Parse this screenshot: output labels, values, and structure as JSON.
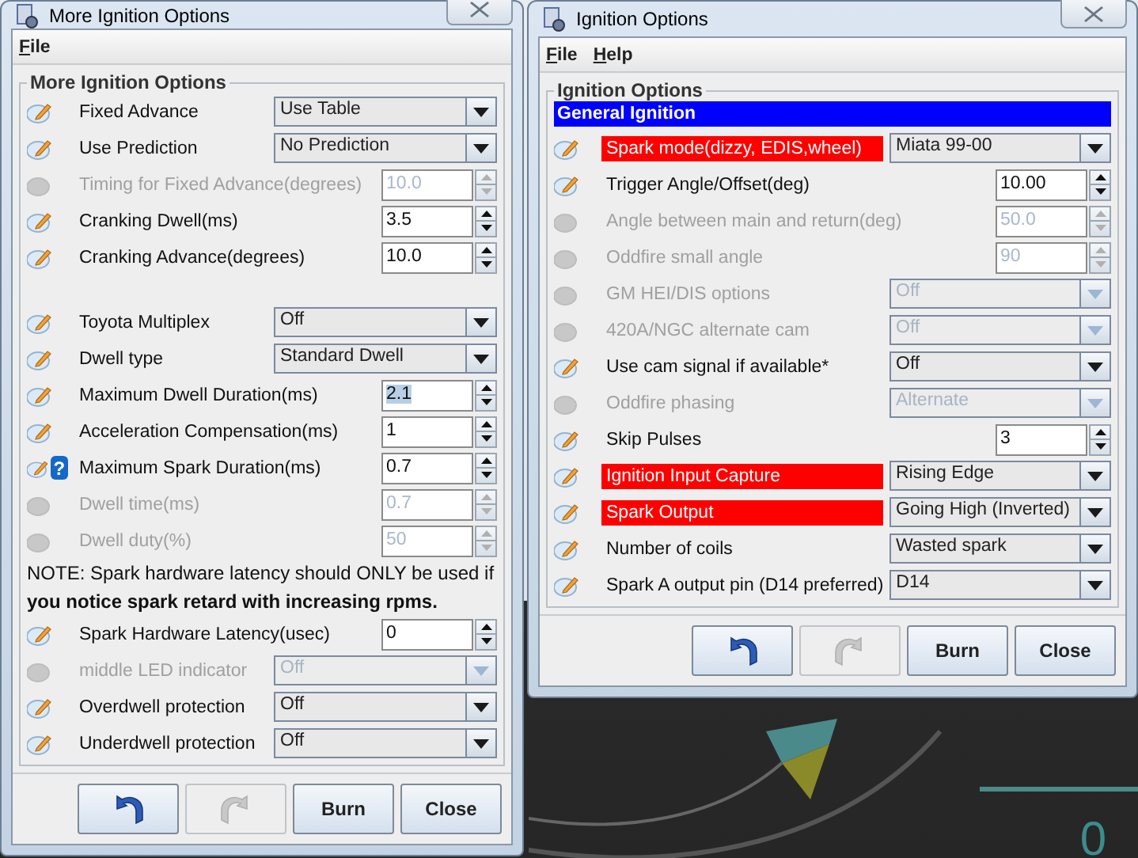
{
  "windows": [
    {
      "title": "More Ignition Options",
      "menu": [
        {
          "label": "File"
        }
      ],
      "group_title": "More Ignition Options",
      "rows": [
        {
          "kind": "combo",
          "label": "Fixed Advance",
          "value": "Use Table",
          "disabled": false,
          "highlighted": false
        },
        {
          "kind": "combo",
          "label": "Use Prediction",
          "value": "No Prediction",
          "disabled": false,
          "highlighted": false
        },
        {
          "kind": "spinner",
          "label": "Timing for Fixed Advance(degrees)",
          "value": "10.0",
          "disabled": true,
          "highlighted": false,
          "text_selected": false
        },
        {
          "kind": "spinner",
          "label": "Cranking Dwell(ms)",
          "value": "3.5",
          "disabled": false,
          "highlighted": false,
          "text_selected": false
        },
        {
          "kind": "spinner",
          "label": "Cranking Advance(degrees)",
          "value": "10.0",
          "disabled": false,
          "highlighted": false,
          "text_selected": false
        },
        {
          "kind": "spacer"
        },
        {
          "kind": "combo",
          "label": "Toyota Multiplex",
          "value": "Off",
          "disabled": false,
          "highlighted": false
        },
        {
          "kind": "combo",
          "label": "Dwell type",
          "value": "Standard Dwell",
          "disabled": false,
          "highlighted": false
        },
        {
          "kind": "spinner",
          "label": "Maximum Dwell Duration(ms)",
          "value": "2.1",
          "disabled": false,
          "highlighted": false,
          "text_selected": true
        },
        {
          "kind": "spinner",
          "label": "Acceleration Compensation(ms)",
          "value": "1",
          "disabled": false,
          "highlighted": false,
          "text_selected": false
        },
        {
          "kind": "spinner",
          "label": "Maximum Spark Duration(ms)",
          "value": "0.7",
          "disabled": false,
          "help_mark": "?",
          "highlighted": false,
          "text_selected": false
        },
        {
          "kind": "spinner",
          "label": "Dwell time(ms)",
          "value": "0.7",
          "disabled": true,
          "highlighted": false,
          "text_selected": false
        },
        {
          "kind": "spinner",
          "label": "Dwell duty(%)",
          "value": "50",
          "disabled": true,
          "highlighted": false,
          "text_selected": false
        },
        {
          "kind": "note",
          "text": "NOTE: Spark hardware latency should ONLY be used if **you notice spark retard with increasing rpms.**"
        },
        {
          "kind": "spinner",
          "label": "Spark Hardware Latency(usec)",
          "value": "0",
          "disabled": false,
          "highlighted": false,
          "text_selected": false
        },
        {
          "kind": "combo",
          "label": "middle LED indicator",
          "value": "Off",
          "disabled": true,
          "highlighted": false
        },
        {
          "kind": "combo",
          "label": "Overdwell protection",
          "value": "Off",
          "disabled": false,
          "highlighted": false
        },
        {
          "kind": "combo",
          "label": "Underdwell protection",
          "value": "Off",
          "disabled": false,
          "highlighted": false
        }
      ],
      "buttons": [
        {
          "kind": "undo",
          "disabled": false
        },
        {
          "kind": "redo",
          "disabled": true
        },
        {
          "kind": "text",
          "label": "Burn",
          "disabled": false
        },
        {
          "kind": "text",
          "label": "Close",
          "disabled": false
        }
      ]
    },
    {
      "title": "Ignition Options",
      "menu": [
        {
          "label": "File"
        },
        {
          "label": "Help"
        }
      ],
      "group_title": "Ignition Options",
      "rows": [
        {
          "kind": "section",
          "label": "General Ignition"
        },
        {
          "kind": "combo",
          "label": "Spark mode(dizzy, EDIS,wheel)",
          "value": "Miata 99-00",
          "disabled": false,
          "highlighted": true
        },
        {
          "kind": "spinner",
          "label": "Trigger Angle/Offset(deg)",
          "value": "10.00",
          "disabled": false,
          "highlighted": false,
          "text_selected": false
        },
        {
          "kind": "spinner",
          "label": "Angle between main and return(deg)",
          "value": "50.0",
          "disabled": true,
          "highlighted": false,
          "text_selected": false
        },
        {
          "kind": "spinner",
          "label": "Oddfire small angle",
          "value": "90",
          "disabled": true,
          "highlighted": false,
          "text_selected": false
        },
        {
          "kind": "combo",
          "label": "GM HEI/DIS options",
          "value": "Off",
          "disabled": true,
          "highlighted": false
        },
        {
          "kind": "combo",
          "label": "420A/NGC alternate cam",
          "value": "Off",
          "disabled": true,
          "highlighted": false
        },
        {
          "kind": "combo",
          "label": "Use cam signal if available*",
          "value": "Off",
          "disabled": false,
          "highlighted": false
        },
        {
          "kind": "combo",
          "label": "Oddfire phasing",
          "value": "Alternate",
          "disabled": true,
          "highlighted": false
        },
        {
          "kind": "spinner",
          "label": "Skip Pulses",
          "value": "3",
          "disabled": false,
          "highlighted": false,
          "text_selected": false
        },
        {
          "kind": "combo",
          "label": "Ignition Input Capture",
          "value": "Rising Edge",
          "disabled": false,
          "highlighted": true
        },
        {
          "kind": "combo",
          "label": "Spark Output",
          "value": "Going High (Inverted)",
          "disabled": false,
          "highlighted": true
        },
        {
          "kind": "combo",
          "label": "Number of coils",
          "value": "Wasted spark",
          "disabled": false,
          "highlighted": false
        },
        {
          "kind": "combo",
          "label": "Spark A output pin (D14 preferred)",
          "value": "D14",
          "disabled": false,
          "highlighted": false
        }
      ],
      "buttons": [
        {
          "kind": "undo",
          "disabled": false
        },
        {
          "kind": "redo",
          "disabled": true
        },
        {
          "kind": "text",
          "label": "Burn",
          "disabled": false
        },
        {
          "kind": "text",
          "label": "Close",
          "disabled": false
        }
      ]
    }
  ],
  "background_gauge": {
    "reading": "0"
  }
}
